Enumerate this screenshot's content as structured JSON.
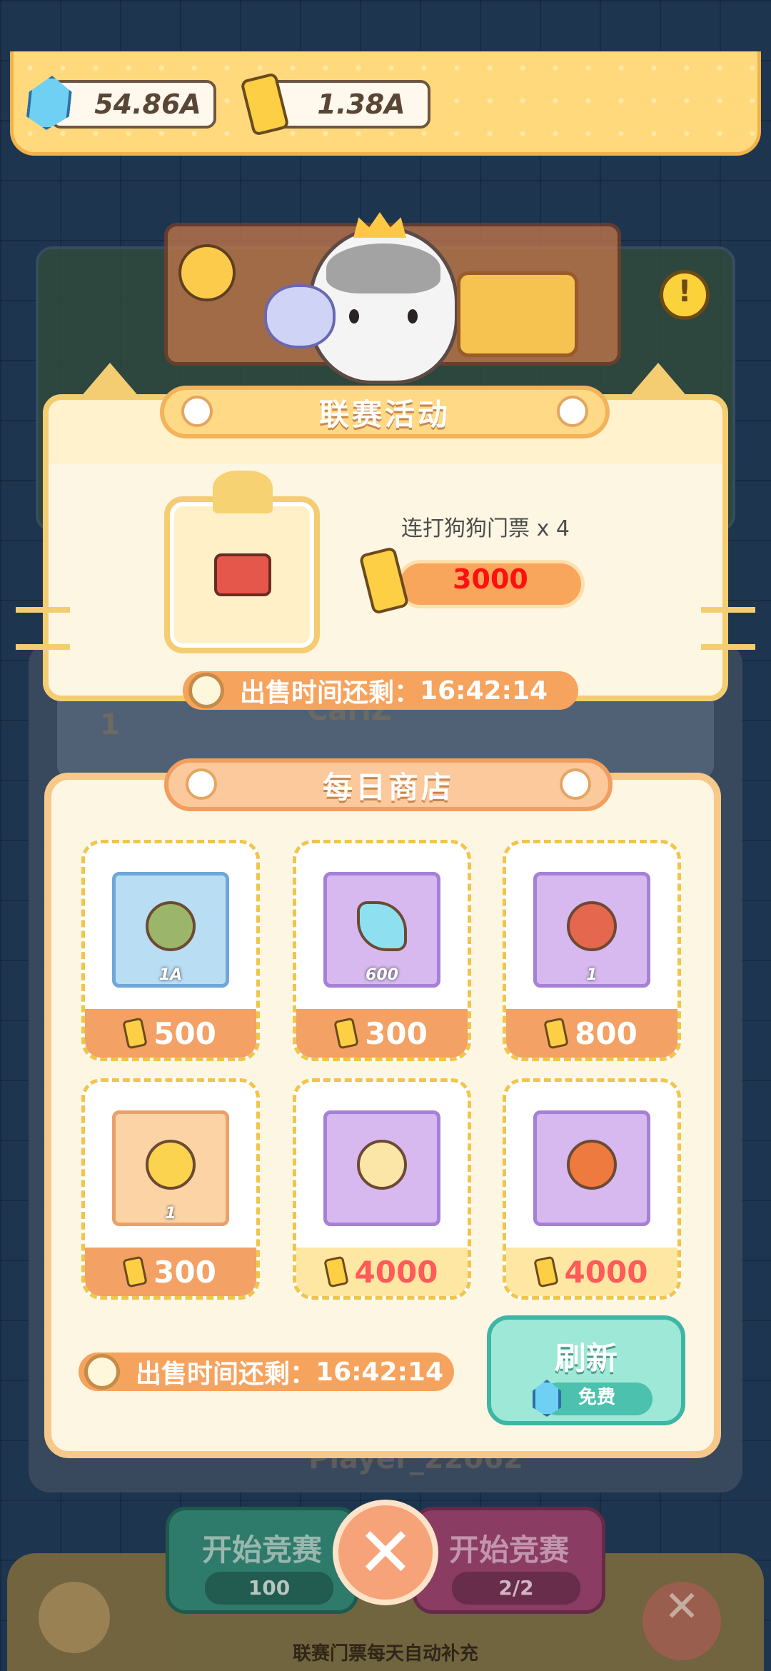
{
  "currencies": {
    "gems": "54.86A",
    "tickets": "1.38A"
  },
  "league": {
    "title": "联赛活动",
    "reward_name": "连打狗狗门票 x 4",
    "price": "3000",
    "timer_label": "出售时间还剩：",
    "timer_value": "16:42:14"
  },
  "shop": {
    "title": "每日商店",
    "items": [
      {
        "icon": "leaf-icon",
        "qty": "1A",
        "price": "500",
        "box_color": "#b9ddf3"
      },
      {
        "icon": "crystal-fish-icon",
        "qty": "600",
        "price": "300",
        "box_color": "#d7b9f0"
      },
      {
        "icon": "ticket-icon",
        "qty": "1",
        "price": "800",
        "box_color": "#d7b9f0"
      },
      {
        "icon": "star-icon",
        "qty": "1",
        "price": "300",
        "box_color": "#fcd3a5"
      },
      {
        "icon": "egg-icon",
        "qty": "",
        "price": "4000",
        "box_color": "#d7b9f0"
      },
      {
        "icon": "slime-icon",
        "qty": "",
        "price": "4000",
        "box_color": "#d7b9f0"
      }
    ],
    "timer_label": "出售时间还剩：",
    "timer_value": "16:42:14",
    "refresh_label": "刷新",
    "refresh_cost": "免费"
  },
  "background": {
    "rank": "1",
    "player_top": "CarlZ",
    "player_bottom": "Player_22062",
    "start_left_label": "开始竞赛",
    "start_left_cost": "100",
    "start_right_label": "开始竞赛",
    "start_right_count": "2/2",
    "bottom_note": "联赛门票每天自动补充"
  },
  "colors": {
    "accent_orange": "#f3a165",
    "price_red": "#ff1010",
    "refresh_teal": "#9ee8d7"
  }
}
